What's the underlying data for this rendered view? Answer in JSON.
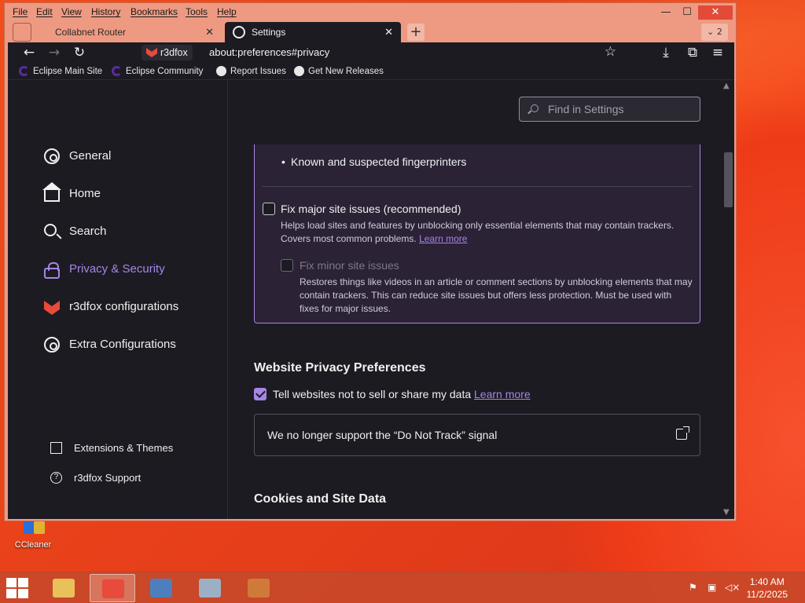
{
  "desktop": {
    "icons": [
      {
        "label": "CCleaner"
      }
    ]
  },
  "menubar": {
    "items": [
      "File",
      "Edit",
      "View",
      "History",
      "Bookmarks",
      "Tools",
      "Help"
    ]
  },
  "window_controls": {
    "minimize": "—",
    "maximize": "☐",
    "close": "✕"
  },
  "tabs": [
    {
      "title": "Collabnet Router",
      "close": "✕",
      "active": false
    },
    {
      "title": "Settings",
      "close": "✕",
      "active": true
    }
  ],
  "tabbar": {
    "new_tab": "+",
    "tab_count": "2"
  },
  "navbar": {
    "back": "←",
    "forward": "→",
    "reload": "↻",
    "identity_label": "r3dfox",
    "url": "about:preferences#privacy",
    "bookmark_star": "☆",
    "downloads": "⤓",
    "extensions": "⧉",
    "menu": "≡"
  },
  "bookmarks": [
    {
      "label": "Eclipse Main Site",
      "icon": "eclipse-icon"
    },
    {
      "label": "Eclipse Community",
      "icon": "eclipse-icon"
    },
    {
      "label": "Report Issues",
      "icon": "github-icon"
    },
    {
      "label": "Get New Releases",
      "icon": "github-icon"
    }
  ],
  "sidebar": {
    "categories": [
      {
        "label": "General",
        "icon": "gear-icon",
        "selected": false
      },
      {
        "label": "Home",
        "icon": "home-icon",
        "selected": false
      },
      {
        "label": "Search",
        "icon": "search-icon",
        "selected": false
      },
      {
        "label": "Privacy & Security",
        "icon": "lock-icon",
        "selected": true
      },
      {
        "label": "r3dfox configurations",
        "icon": "r3dfox-icon",
        "selected": false
      },
      {
        "label": "Extra Configurations",
        "icon": "gear-icon",
        "selected": false
      }
    ],
    "footer": [
      {
        "label": "Extensions & Themes",
        "icon": "puzzle-icon"
      },
      {
        "label": "r3dfox Support",
        "icon": "help-icon"
      }
    ]
  },
  "main": {
    "find_placeholder": "Find in Settings",
    "tracking": {
      "bullet": "Known and suspected fingerprinters",
      "fix_major": {
        "label": "Fix major site issues (recommended)",
        "checked": false,
        "desc": "Helps load sites and features by unblocking only essential elements that may contain trackers. Covers most common problems.",
        "link": "Learn more"
      },
      "fix_minor": {
        "label": "Fix minor site issues",
        "checked": false,
        "desc": "Restores things like videos in an article or comment sections by unblocking elements that may contain trackers. This can reduce site issues but offers less protection. Must be used with fixes for major issues."
      }
    },
    "website_privacy": {
      "title": "Website Privacy Preferences",
      "gpc_label": "Tell websites not to sell or share my data",
      "gpc_checked": true,
      "gpc_link": "Learn more",
      "dnt_text": "We no longer support the “Do Not Track” signal"
    },
    "cookies": {
      "title": "Cookies and Site Data"
    }
  },
  "taskbar": {
    "time": "1:40 AM",
    "date": "11/2/2025"
  },
  "colors": {
    "accent": "#a785e6",
    "content_bg": "#1c1b22",
    "desktop": "#e8411a"
  }
}
